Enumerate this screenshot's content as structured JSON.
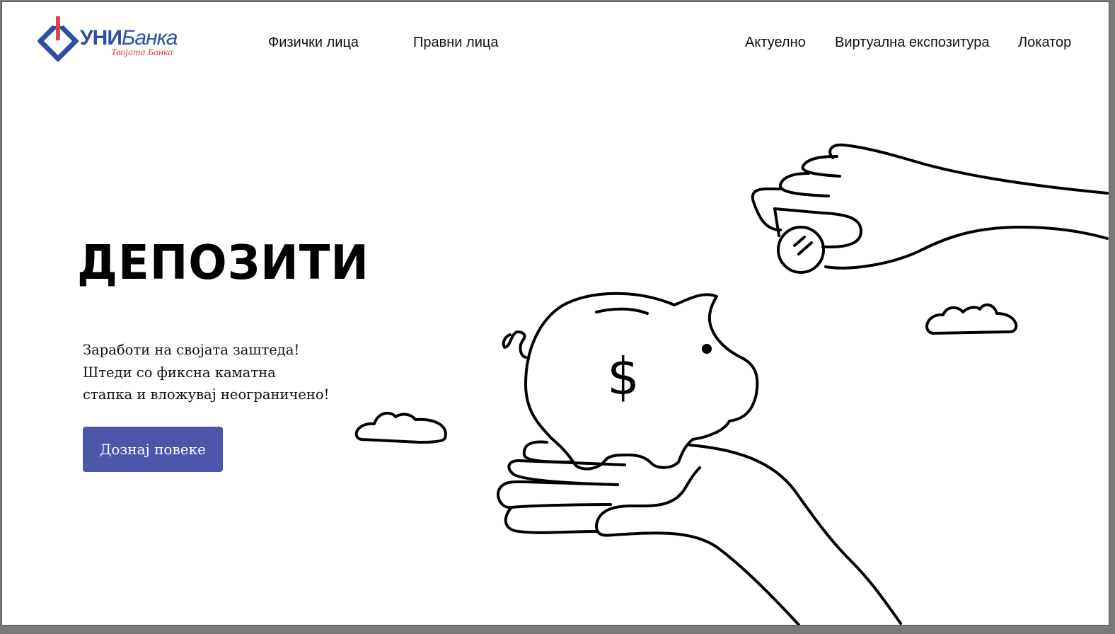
{
  "brand": {
    "name_bold": "УНИ",
    "name_italic": "Банка",
    "tagline": "Твојата Банка",
    "colors": {
      "blue": "#2f4fa3",
      "red": "#e0444b"
    }
  },
  "nav": {
    "primary": [
      {
        "label": "Физички лица"
      },
      {
        "label": "Правни лица"
      }
    ],
    "secondary": [
      {
        "label": "Актуелно"
      },
      {
        "label": "Виртуална експозитура"
      },
      {
        "label": "Локатор"
      }
    ]
  },
  "hero": {
    "title": "ДЕПОЗИТИ",
    "lines": [
      "Заработи на својата заштеда!",
      "Штеди со фиксна каматна",
      "стапка и вложувај неограничено!"
    ],
    "cta_label": "Дознај повеке",
    "cta_color": "#4d56aa",
    "illustration_symbol": "$"
  }
}
